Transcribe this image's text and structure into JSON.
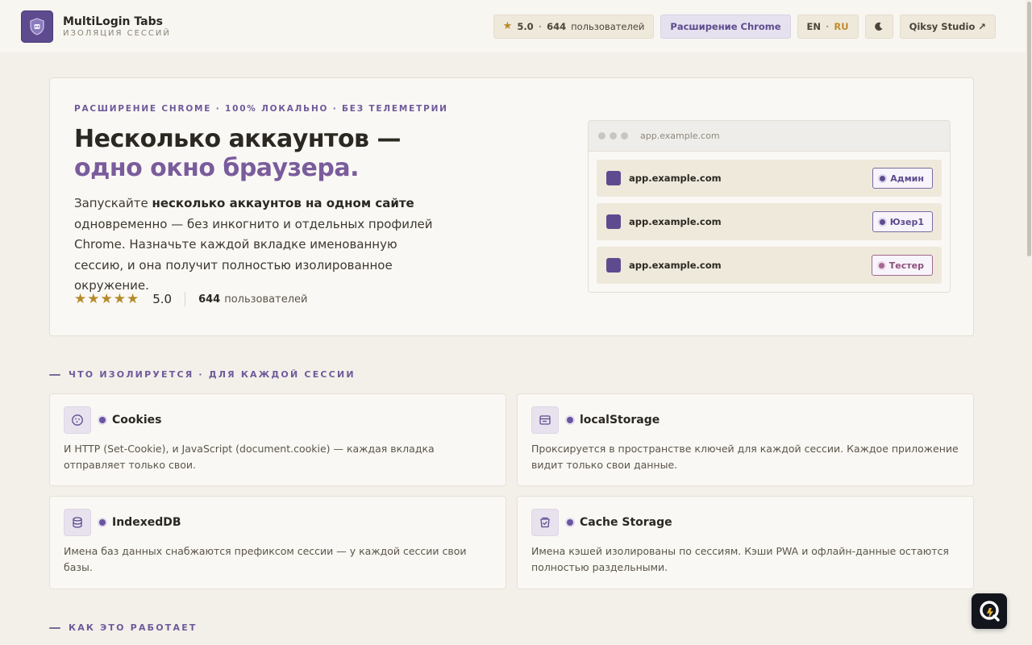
{
  "header": {
    "brand_name": "MultiLogin Tabs",
    "brand_sub": "ИЗОЛЯЦИЯ СЕССИЙ",
    "rating": "5.0",
    "users_count": "644",
    "users_label": "пользователей",
    "chrome_button": "Расширение Chrome",
    "lang_en": "EN",
    "lang_sep": "·",
    "lang_ru": "RU",
    "studio_link": "Qiksy Studio ↗"
  },
  "hero": {
    "kicker": "РАСШИРЕНИЕ CHROME · 100% ЛОКАЛЬНО · БЕЗ ТЕЛЕМЕТРИИ",
    "title_line1": "Несколько аккаунтов —",
    "title_line2": "одно окно браузера.",
    "desc_part1": "Запускайте ",
    "desc_bold": "несколько аккаунтов на одном сайте",
    "desc_part2": " одновременно — без инкогнито и отдельных профилей Chrome. Назначьте каждой вкладке именованную сессию, и она получит полностью изолированное окружение.",
    "stars": "★★★★★",
    "rating": "5.0",
    "users_count": "644",
    "users_label": "пользователей"
  },
  "mock": {
    "url": "app.example.com",
    "tabs": [
      {
        "host": "app.example.com",
        "session": "Админ"
      },
      {
        "host": "app.example.com",
        "session": "Юзер1"
      },
      {
        "host": "app.example.com",
        "session": "Тестер"
      }
    ]
  },
  "isolation": {
    "heading": "ЧТО ИЗОЛИРУЕТСЯ · ДЛЯ КАЖДОЙ СЕССИИ",
    "items": [
      {
        "icon": "cookie-icon",
        "title": "Cookies",
        "desc": "И HTTP (Set-Cookie), и JavaScript (document.cookie) — каждая вкладка отправляет только свои."
      },
      {
        "icon": "storage-icon",
        "title": "localStorage",
        "desc": "Проксируется в пространстве ключей для каждой сессии. Каждое приложение видит только свои данные."
      },
      {
        "icon": "database-icon",
        "title": "IndexedDB",
        "desc": "Имена баз данных снабжаются префиксом сессии — у каждой сессии свои базы."
      },
      {
        "icon": "cache-icon",
        "title": "Cache Storage",
        "desc": "Имена кэшей изолированы по сессиям. Кэши PWA и офлайн-данные остаются полностью раздельными."
      }
    ]
  },
  "how": {
    "heading": "КАК ЭТО РАБОТАЕТ"
  },
  "colors": {
    "accent": "#5e4b8f",
    "title_accent": "#7a5c9c",
    "background": "#f3f0ea",
    "star": "#b58a2a"
  }
}
